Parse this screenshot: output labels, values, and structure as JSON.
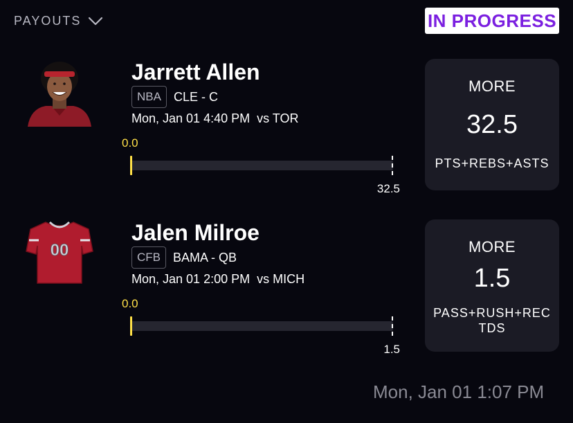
{
  "header": {
    "payouts_label": "PAYOUTS",
    "status": "IN PROGRESS"
  },
  "picks": [
    {
      "player": "Jarrett Allen",
      "league": "NBA",
      "team_position": "CLE - C",
      "game_time": "Mon, Jan 01 4:40 PM  vs TOR",
      "progress_value": "0.0",
      "line_value": "32.5",
      "direction": "MORE",
      "line": "32.5",
      "stat": "PTS+REBS+ASTS",
      "avatar_icon": "player-headshot",
      "progress_fraction": 0
    },
    {
      "player": "Jalen Milroe",
      "league": "CFB",
      "team_position": "BAMA - QB",
      "game_time": "Mon, Jan 01 2:00 PM  vs MICH",
      "progress_value": "0.0",
      "line_value": "1.5",
      "direction": "MORE",
      "line": "1.5",
      "stat_line1": "PASS+RUSH+REC",
      "stat_line2": "TDS",
      "avatar_icon": "jersey-icon",
      "jersey_number": "00",
      "progress_fraction": 0
    }
  ],
  "footer": {
    "timestamp": "Mon, Jan 01 1:07 PM"
  },
  "colors": {
    "background": "#07070f",
    "accent_purple": "#7b1fe0",
    "progress_yellow": "#ffe048",
    "card_bg": "#1b1b25",
    "jersey_red": "#b01c2e"
  }
}
